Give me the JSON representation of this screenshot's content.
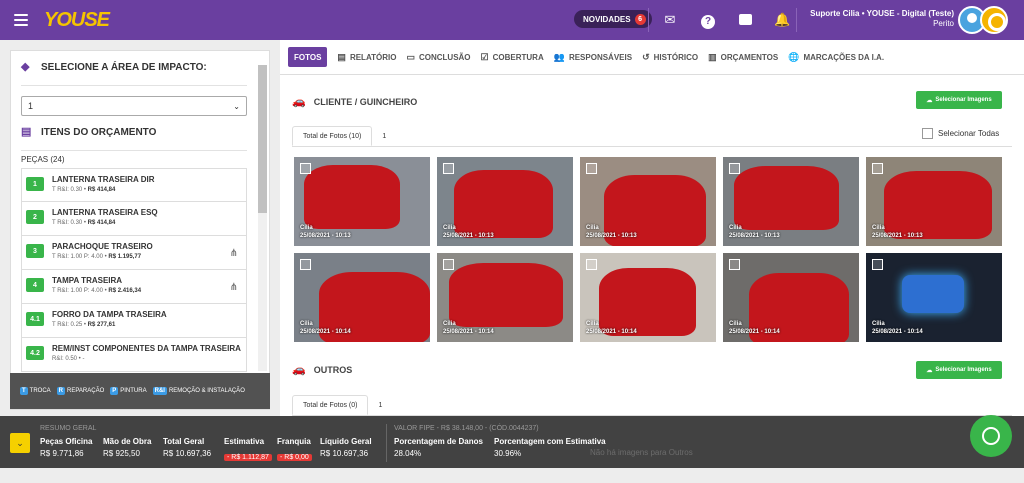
{
  "header": {
    "logo": "YOUSE",
    "novidades_label": "NOVIDADES",
    "novidades_count": "6",
    "user_name": "Suporte Cilia • YOUSE - Digital (Teste)",
    "user_role": "Perito"
  },
  "left": {
    "area_title": "SELECIONE A ÁREA DE IMPACTO:",
    "area_value": "1",
    "items_title": "ITENS DO ORÇAMENTO",
    "pecas_label": "PEÇAS (24)",
    "items": [
      {
        "num": "1",
        "title": "LANTERNA TRASEIRA DIR",
        "sub": "T R&I: 0.30 • ",
        "price": "R$ 414,84",
        "tree": false
      },
      {
        "num": "2",
        "title": "LANTERNA TRASEIRA ESQ",
        "sub": "T R&I: 0.30 • ",
        "price": "R$ 414,84",
        "tree": false
      },
      {
        "num": "3",
        "title": "PARACHOQUE TRASEIRO",
        "sub": "T R&I: 1.00 P: 4.00 • ",
        "price": "R$ 1.195,77",
        "tree": true
      },
      {
        "num": "4",
        "title": "TAMPA TRASEIRA",
        "sub": "T R&I: 1.00 P: 4.00 • ",
        "price": "R$ 2.416,34",
        "tree": true
      },
      {
        "num": "4.1",
        "title": "FORRO DA TAMPA TRASEIRA",
        "sub": "T R&I: 0.25 • ",
        "price": "R$ 277,61",
        "tree": false
      },
      {
        "num": "4.2",
        "title": "REM/INST COMPONENTES DA TAMPA TRASEIRA",
        "sub": "R&I: 0.50 • -",
        "price": "",
        "tree": false
      }
    ],
    "legend": [
      {
        "key": "T",
        "label": "TROCA"
      },
      {
        "key": "R",
        "label": "REPARAÇÃO"
      },
      {
        "key": "P",
        "label": "PINTURA"
      },
      {
        "key": "R&I",
        "label": "REMOÇÃO & INSTALAÇÃO"
      }
    ]
  },
  "tabs": [
    "FOTOS",
    "RELATÓRIO",
    "CONCLUSÃO",
    "COBERTURA",
    "RESPONSÁVEIS",
    "HISTÓRICO",
    "ORÇAMENTOS",
    "MARCAÇÕES DA I.A."
  ],
  "cliente": {
    "title": "CLIENTE / GUINCHEIRO",
    "button": "Selecionar Imagens",
    "subtab1": "Total de Fotos (10)",
    "subtab2": "1",
    "select_all": "Selecionar Todas",
    "photos": [
      {
        "name": "Cilia",
        "date": "25/08/2021 - 10:13"
      },
      {
        "name": "Cilia",
        "date": "25/08/2021 - 10:13"
      },
      {
        "name": "Cilia",
        "date": "25/08/2021 - 10:13"
      },
      {
        "name": "Cilia",
        "date": "25/08/2021 - 10:13"
      },
      {
        "name": "Cilia",
        "date": "25/08/2021 - 10:13"
      },
      {
        "name": "Cilia",
        "date": "25/08/2021 - 10:14"
      },
      {
        "name": "Cilia",
        "date": "25/08/2021 - 10:14"
      },
      {
        "name": "Cilia",
        "date": "25/08/2021 - 10:14"
      },
      {
        "name": "Cilia",
        "date": "25/08/2021 - 10:14"
      },
      {
        "name": "Cilia",
        "date": "25/08/2021 - 10:14"
      }
    ]
  },
  "outros": {
    "title": "OUTROS",
    "button": "Selecionar Imagens",
    "subtab1": "Total de Fotos (0)",
    "subtab2": "1",
    "empty": "Não há imagens para Outros"
  },
  "footer": {
    "resumo": "RESUMO GERAL",
    "valor_fipe": "VALOR FIPE - R$ 38.148,00 - (CÓD.0044237)",
    "cols": [
      {
        "label": "Peças Oficina",
        "value": "R$ 9.771,86"
      },
      {
        "label": "Mão de Obra",
        "value": "R$ 925,50"
      },
      {
        "label": "Total Geral",
        "value": "R$ 10.697,36"
      },
      {
        "label": "Estimativa",
        "value": "- R$ 1.112,87"
      },
      {
        "label": "Franquia",
        "value": "- R$ 0,00"
      },
      {
        "label": "Líquido Geral",
        "value": "R$ 10.697,36"
      }
    ],
    "pct": [
      {
        "label": "Porcentagem de Danos",
        "value": "28.04%"
      },
      {
        "label": "Porcentagem com Estimativa",
        "value": "30.96%"
      }
    ]
  }
}
